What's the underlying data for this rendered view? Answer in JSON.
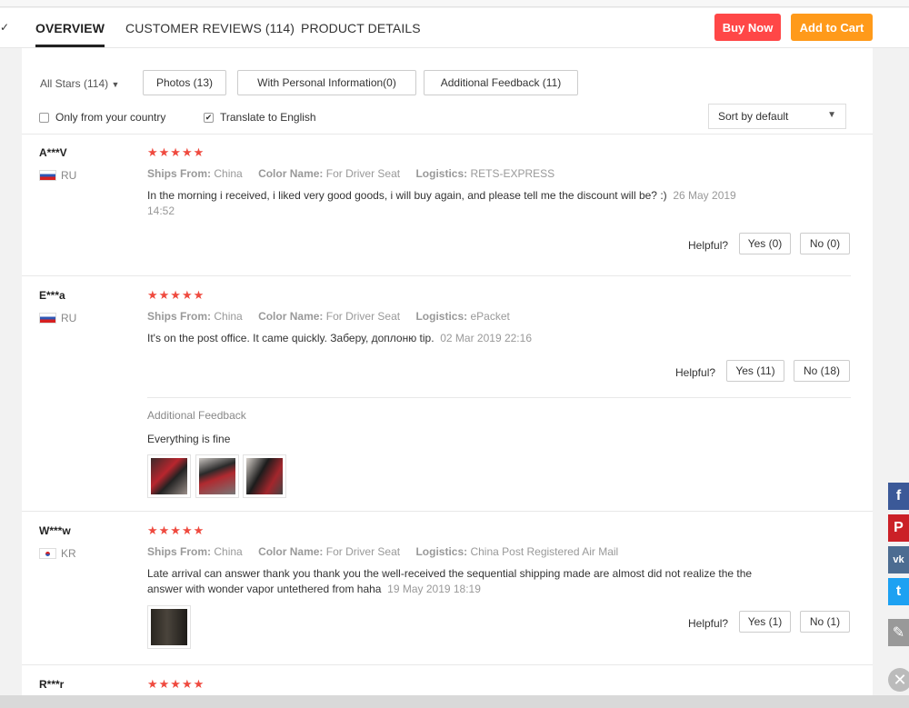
{
  "nav": {
    "tabs": [
      {
        "label": "OVERVIEW",
        "active": true
      },
      {
        "label": "CUSTOMER REVIEWS (114)",
        "active": false
      },
      {
        "label": "PRODUCT DETAILS",
        "active": false
      }
    ],
    "buy_now": "Buy Now",
    "add_to_cart": "Add to Cart",
    "colors": {
      "buy_now": "#ff4747",
      "add_to_cart": "#ff9a1a"
    }
  },
  "filters": {
    "all_stars": "All Stars (114)",
    "photos": "Photos (13)",
    "personal_info": "With Personal Information(0)",
    "additional_feedback": "Additional Feedback (11)",
    "only_country": "Only from your country",
    "only_country_checked": false,
    "translate": "Translate to English",
    "translate_checked": true,
    "sort": "Sort by default"
  },
  "labels": {
    "ships_from": "Ships From:",
    "color_name": "Color Name:",
    "logistics": "Logistics:",
    "helpful": "Helpful?",
    "additional_feedback": "Additional Feedback"
  },
  "reviews": [
    {
      "user": "A***V",
      "country": "RU",
      "stars": "★★★★★",
      "ships_from": "China",
      "color_name": "For Driver Seat",
      "logistics": "RETS-EXPRESS",
      "text": "In the morning i received, i liked very good goods, i will buy again, and please tell me the discount will be? :)",
      "date": "26 May 2019 14:52",
      "yes": "Yes (0)",
      "no": "No (0)"
    },
    {
      "user": "E***a",
      "country": "RU",
      "stars": "★★★★★",
      "ships_from": "China",
      "color_name": "For Driver Seat",
      "logistics": "ePacket",
      "text": "It's on the post office. It came quickly. Заберу, доплоню tip.",
      "date": "02 Mar 2019 22:16",
      "yes": "Yes (11)",
      "no": "No (18)",
      "additional_text": "Everything is fine"
    },
    {
      "user": "W***w",
      "country": "KR",
      "stars": "★★★★★",
      "ships_from": "China",
      "color_name": "For Driver Seat",
      "logistics": "China Post Registered Air Mail",
      "text": "Late arrival can answer thank you thank you the well-received the sequential shipping made are almost did not realize the the answer with wonder vapor untethered from haha",
      "date": "19 May 2019 18:19",
      "yes": "Yes (1)",
      "no": "No (1)"
    },
    {
      "user": "R***r",
      "stars": "★★★★★"
    }
  ],
  "social": {
    "facebook": "f",
    "pinterest": "P",
    "vk": "vk",
    "twitter": "t",
    "edit": "✎",
    "close": "✕"
  }
}
